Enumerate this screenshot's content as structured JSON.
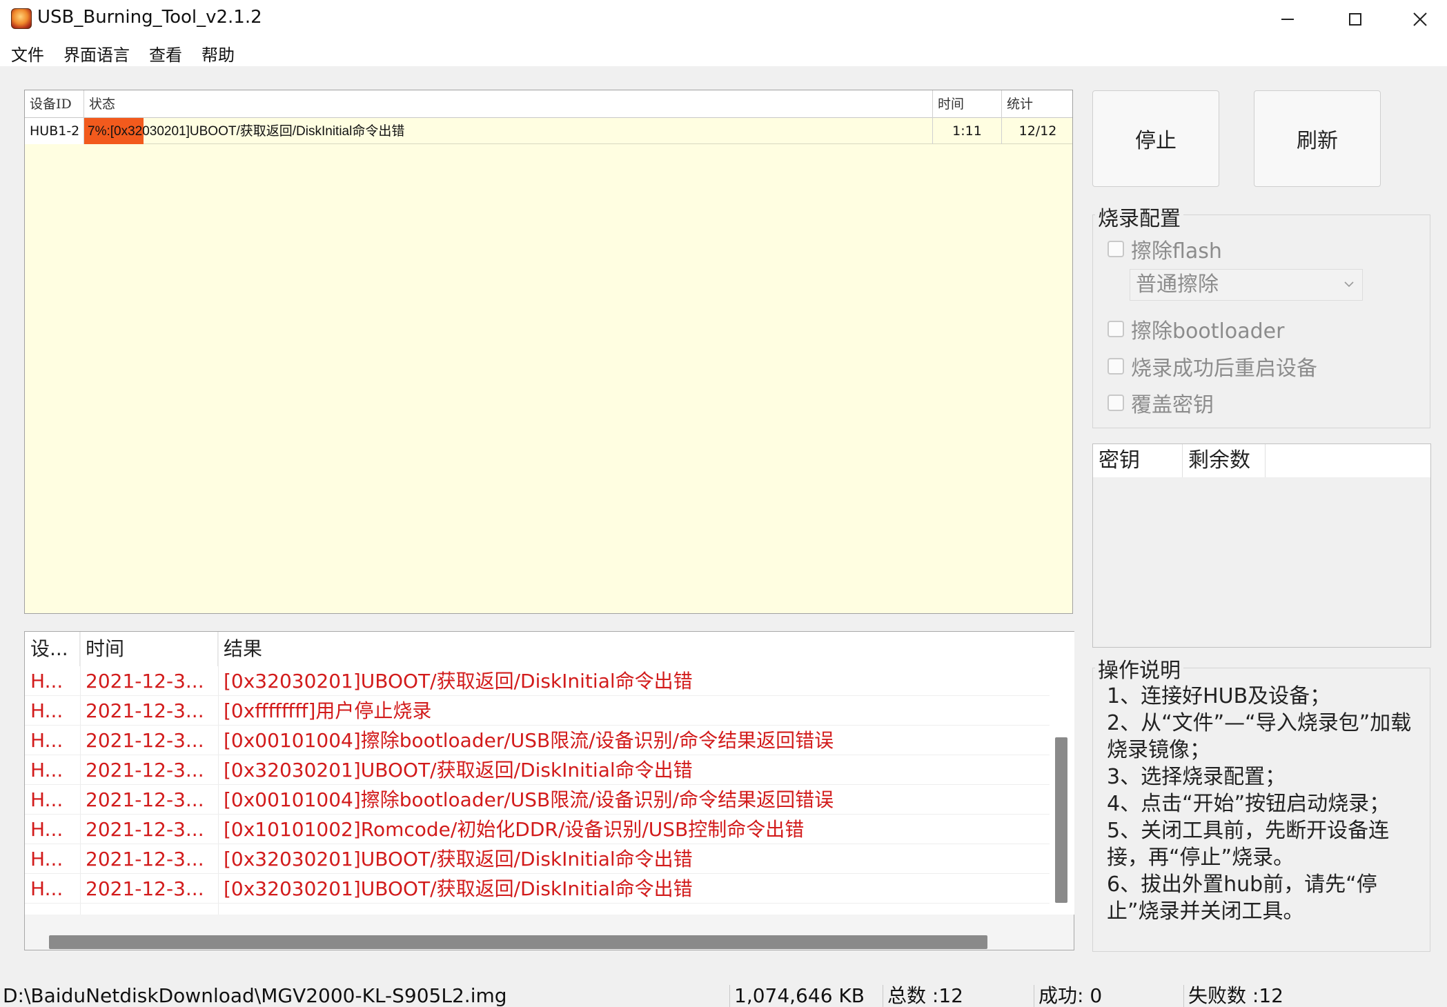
{
  "window": {
    "title": "USB_Burning_Tool_v2.1.2"
  },
  "menu": [
    "文件",
    "界面语言",
    "查看",
    "帮助"
  ],
  "device_table": {
    "headers": {
      "id": "设备ID",
      "status": "状态",
      "time": "时间",
      "stats": "统计"
    },
    "rows": [
      {
        "id": "HUB1-2",
        "status_prefix": "7%:[0x32030201]UBOOT/",
        "status_cjk1": "获取返回",
        "status_mid": "/DiskInitial",
        "status_cjk2": "命令出错",
        "progress_percent": 7,
        "time": "1:11",
        "stats": "12/12"
      }
    ]
  },
  "log_table": {
    "headers": {
      "device": "设...",
      "time": "时间",
      "result": "结果"
    },
    "rows": [
      {
        "device": "H...",
        "time": "2021-12-3...",
        "result": "[0x32030201]UBOOT/获取返回/DiskInitial命令出错"
      },
      {
        "device": "H...",
        "time": "2021-12-3...",
        "result": "[0xffffffff]用户停止烧录"
      },
      {
        "device": "H...",
        "time": "2021-12-3...",
        "result": "[0x00101004]擦除bootloader/USB限流/设备识别/命令结果返回错误"
      },
      {
        "device": "H...",
        "time": "2021-12-3...",
        "result": "[0x32030201]UBOOT/获取返回/DiskInitial命令出错"
      },
      {
        "device": "H...",
        "time": "2021-12-3...",
        "result": "[0x00101004]擦除bootloader/USB限流/设备识别/命令结果返回错误"
      },
      {
        "device": "H...",
        "time": "2021-12-3...",
        "result": "[0x10101002]Romcode/初始化DDR/设备识别/USB控制命令出错"
      },
      {
        "device": "H...",
        "time": "2021-12-3...",
        "result": "[0x32030201]UBOOT/获取返回/DiskInitial命令出错"
      },
      {
        "device": "H...",
        "time": "2021-12-3...",
        "result": "[0x32030201]UBOOT/获取返回/DiskInitial命令出错"
      }
    ]
  },
  "buttons": {
    "stop": "停止",
    "refresh": "刷新"
  },
  "burn_config": {
    "title": "烧录配置",
    "erase_flash": "擦除flash",
    "erase_mode": "普通擦除",
    "erase_bootloader": "擦除bootloader",
    "reboot_after": "烧录成功后重启设备",
    "overwrite_key": "覆盖密钥"
  },
  "key_table": {
    "headers": {
      "key": "密钥",
      "remaining": "剩余数"
    }
  },
  "instructions": {
    "title": "操作说明",
    "steps": [
      "1、连接好HUB及设备；",
      "2、从“文件”—“导入烧录包”加载烧录镜像；",
      "3、选择烧录配置；",
      "4、点击“开始”按钮启动烧录；",
      "5、关闭工具前，先断开设备连接，再“停止”烧录。",
      "6、拔出外置hub前，请先“停止”烧录并关闭工具。"
    ]
  },
  "statusbar": {
    "path": "D:\\BaiduNetdiskDownload\\MGV2000-KL-S905L2.img",
    "size": "1,074,646 KB",
    "total": "总数 :12",
    "success": "成功:  0",
    "fail": "失败数 :12"
  },
  "colors": {
    "progress": "#f25a1d",
    "device_bg": "#fffee1",
    "log_error": "#d21b1b"
  }
}
